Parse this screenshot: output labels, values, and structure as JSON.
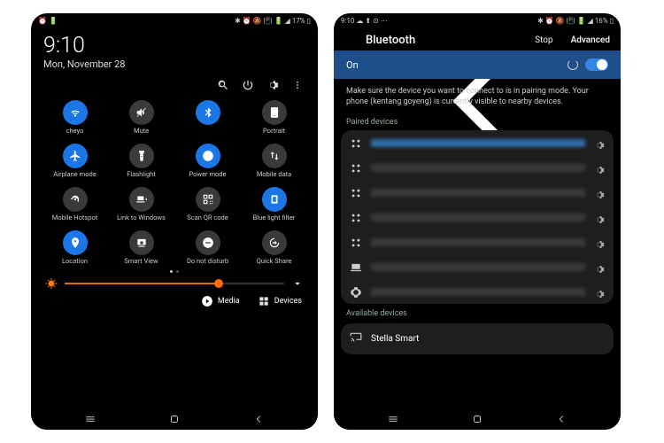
{
  "phoneA": {
    "status": {
      "left_icons": "⏰ 🔋",
      "right_text": "✱ ⏰ 🔕 📳 🔋 ◢ 17% ▯"
    },
    "time": "9:10",
    "date": "Mon, November 28",
    "tiles": [
      {
        "label": "cheyo",
        "on": true,
        "icon": "wifi"
      },
      {
        "label": "Mute",
        "on": false,
        "icon": "mute"
      },
      {
        "label": "",
        "on": true,
        "icon": "bluetooth"
      },
      {
        "label": "Portrait",
        "on": false,
        "icon": "portrait"
      },
      {
        "label": "Airplane mode",
        "on": true,
        "icon": "airplane"
      },
      {
        "label": "Flashlight",
        "on": false,
        "icon": "flashlight"
      },
      {
        "label": "Power mode",
        "on": true,
        "icon": "power"
      },
      {
        "label": "Mobile data",
        "on": false,
        "icon": "mobiledata"
      },
      {
        "label": "Mobile Hotspot",
        "on": false,
        "icon": "hotspot"
      },
      {
        "label": "Link to Windows",
        "on": false,
        "icon": "link"
      },
      {
        "label": "Scan QR code",
        "on": false,
        "icon": "qr"
      },
      {
        "label": "Blue light filter",
        "on": true,
        "icon": "blf"
      },
      {
        "label": "Location",
        "on": true,
        "icon": "location"
      },
      {
        "label": "Smart View",
        "on": false,
        "icon": "smartview"
      },
      {
        "label": "Do not disturb",
        "on": false,
        "icon": "dnd"
      },
      {
        "label": "Quick Share",
        "on": false,
        "icon": "quickshare"
      }
    ],
    "brightness_pct": 70,
    "media_label": "Media",
    "devices_label": "Devices"
  },
  "phoneB": {
    "status": {
      "left_text": "9:10 ☁ ⬆ ⊙ ⋯",
      "right_text": "✱ ⏰ 🔕 📳 🔋 ◢ 16% ▯"
    },
    "title": "Bluetooth",
    "action_stop": "Stop",
    "action_adv": "Advanced",
    "toggle_label": "On",
    "hint": "Make sure the device you want to connect to is in pairing mode. Your phone (kentang goyeng) is currently visible to nearby devices.",
    "paired_label": "Paired devices",
    "paired": [
      {
        "icon": "grid",
        "highlight": true
      },
      {
        "icon": "grid"
      },
      {
        "icon": "grid"
      },
      {
        "icon": "grid"
      },
      {
        "icon": "grid"
      },
      {
        "icon": "laptop"
      },
      {
        "icon": "watch"
      }
    ],
    "avail_label": "Available devices",
    "avail_name": "Stella Smart"
  }
}
